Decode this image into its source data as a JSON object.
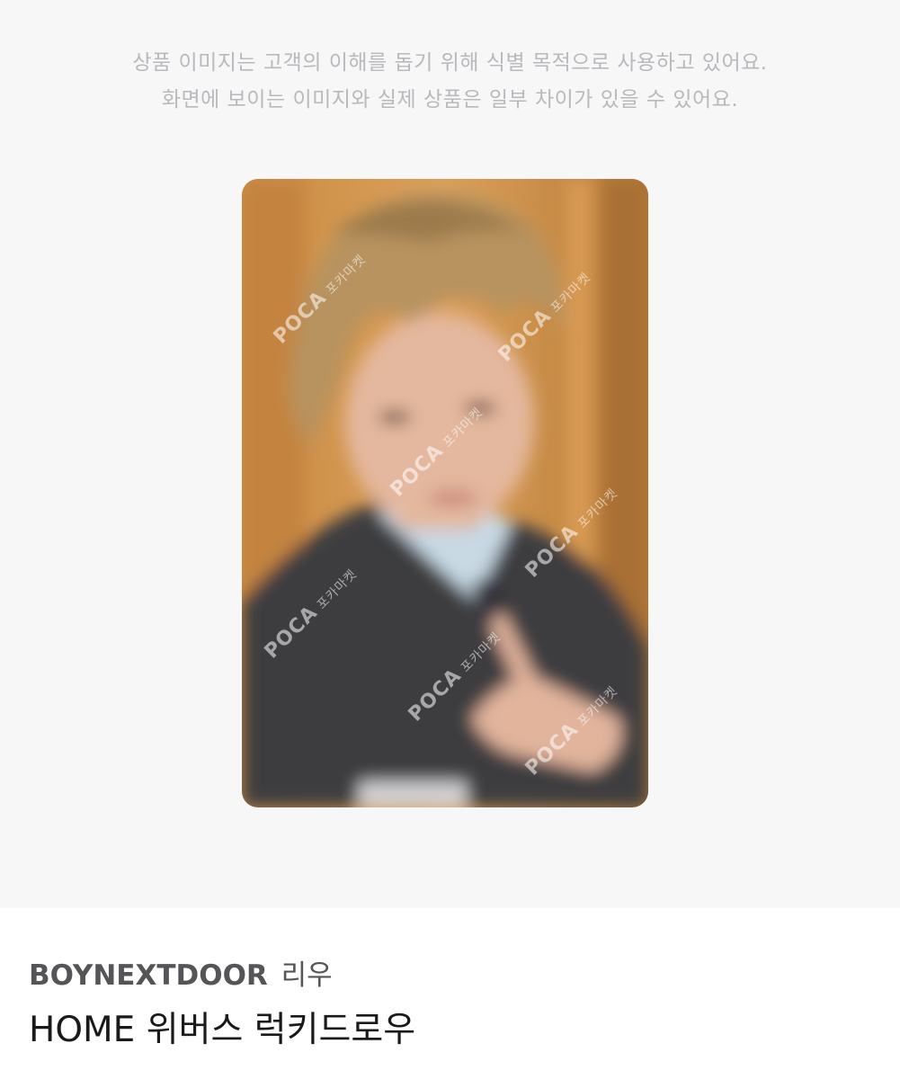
{
  "notice": {
    "line1": "상품 이미지는 고객의 이해를 돕기 위해 식별 목적으로 사용하고 있어요.",
    "line2": "화면에 보이는 이미지와 실제 상품은 일부 차이가 있을 수 있어요."
  },
  "photocard": {
    "watermark_text": "POCA",
    "watermark_sub": "포카마켓"
  },
  "product": {
    "brand": "BOYNEXTDOOR",
    "member": "리우",
    "title": "HOME 위버스 럭키드로우"
  },
  "colors": {
    "hero_background": "#f7f7f8",
    "notice_text": "#b9b9bd",
    "brand_text": "#555558",
    "title_text": "#1a1a1a"
  }
}
